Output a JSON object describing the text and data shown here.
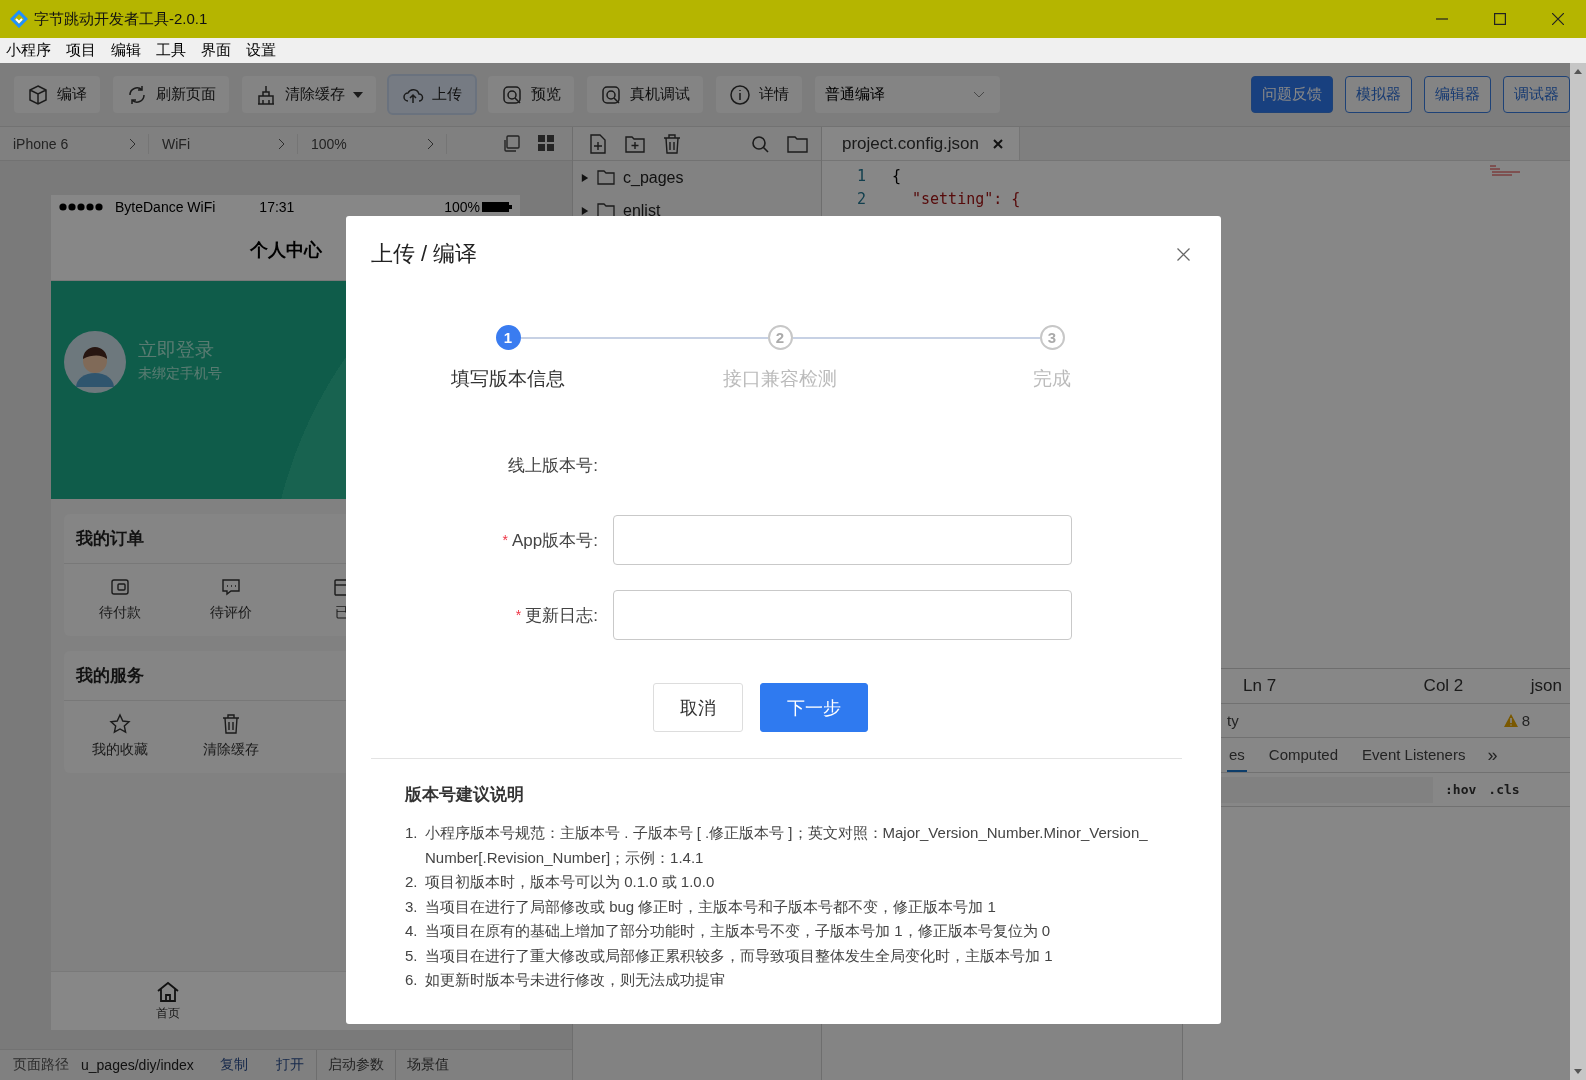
{
  "window": {
    "title": "字节跳动开发者工具-2.0.1"
  },
  "menu": [
    "小程序",
    "项目",
    "编辑",
    "工具",
    "界面",
    "设置"
  ],
  "toolbar": {
    "buttons": [
      {
        "label": "编译",
        "selected": false,
        "dropdown": false
      },
      {
        "label": "刷新页面",
        "selected": false,
        "dropdown": false
      },
      {
        "label": "清除缓存",
        "selected": false,
        "dropdown": true
      },
      {
        "label": "上传",
        "selected": true,
        "dropdown": false
      },
      {
        "label": "预览",
        "selected": false,
        "dropdown": false
      },
      {
        "label": "真机调试",
        "selected": false,
        "dropdown": false
      },
      {
        "label": "详情",
        "selected": false,
        "dropdown": false
      }
    ],
    "compile_mode": "普通编译",
    "view_buttons": [
      {
        "label": "问题反馈",
        "selected": true
      },
      {
        "label": "模拟器",
        "selected": false
      },
      {
        "label": "编辑器",
        "selected": false
      },
      {
        "label": "调试器",
        "selected": false
      }
    ]
  },
  "device_bar": [
    "iPhone 6",
    "WiFi",
    "100%"
  ],
  "phone": {
    "status_bar": {
      "carrier": "ByteDance WiFi",
      "time": "17:31",
      "battery": "100%"
    },
    "nav_title": "个人中心",
    "profile": {
      "name": "立即登录",
      "subtitle": "未绑定手机号"
    },
    "sections": [
      {
        "title": "我的订单",
        "items": [
          "待付款",
          "待评价",
          "已"
        ]
      },
      {
        "title": "我的服务",
        "items": [
          "我的收藏",
          "清除缓存"
        ]
      }
    ],
    "tab_bar": [
      "首页"
    ]
  },
  "path_bar": {
    "label": "页面路径",
    "path": "u_pages/diy/index",
    "links": [
      "复制",
      "打开"
    ],
    "buttons": [
      "启动参数",
      "场景值"
    ]
  },
  "file_tree": [
    {
      "name": "c_pages",
      "expanded": false
    },
    {
      "name": "enlist",
      "expanded": false
    }
  ],
  "editor": {
    "tab": "project.config.json",
    "lines": [
      {
        "number": "1",
        "code": "{"
      },
      {
        "number": "2",
        "code": "\"setting\": {"
      }
    ],
    "status": {
      "line": "Ln 7",
      "column": "Col 2",
      "language": "json"
    }
  },
  "devtools": {
    "panel_text": "ty",
    "warnings": "8",
    "tabs": [
      {
        "label": "es",
        "selected": true
      },
      {
        "label": "Computed",
        "selected": false
      },
      {
        "label": "Event Listeners",
        "selected": false
      }
    ],
    "more": "»",
    "filter_buttons": [
      ":hov",
      ".cls"
    ]
  },
  "dialog": {
    "title": "上传 / 编译",
    "steps": [
      {
        "number": "1",
        "label": "填写版本信息",
        "selected": true
      },
      {
        "number": "2",
        "label": "接口兼容检测",
        "selected": false
      },
      {
        "number": "3",
        "label": "完成",
        "selected": false
      }
    ],
    "fields": [
      {
        "kind": "text",
        "label": "线上版本号:"
      },
      {
        "kind": "input",
        "label": "App版本号:",
        "required_mark": "*"
      },
      {
        "kind": "input",
        "label": "更新日志:",
        "required_mark": "*"
      }
    ],
    "buttons": [
      {
        "label": "取消",
        "primary": false
      },
      {
        "label": "下一步",
        "primary": true
      }
    ],
    "notes": {
      "title": "版本号建议说明",
      "items": [
        {
          "number": "1.",
          "text": "小程序版本号规范：主版本号 . 子版本号 [ .修正版本号 ]；英文对照：Major_Version_Number.Minor_Version_Number[.Revision_Number]；示例：1.4.1"
        },
        {
          "number": "2.",
          "text": "项目初版本时，版本号可以为 0.1.0 或 1.0.0"
        },
        {
          "number": "3.",
          "text": "当项目在进行了局部修改或 bug 修正时，主版本号和子版本号都不变，修正版本号加 1"
        },
        {
          "number": "4.",
          "text": "当项目在原有的基础上增加了部分功能时，主版本号不变，子版本号加 1，修正版本号复位为 0"
        },
        {
          "number": "5.",
          "text": "当项目在进行了重大修改或局部修正累积较多，而导致项目整体发生全局变化时，主版本号加 1"
        },
        {
          "number": "6.",
          "text": "如更新时版本号未进行修改，则无法成功提审"
        }
      ]
    }
  }
}
